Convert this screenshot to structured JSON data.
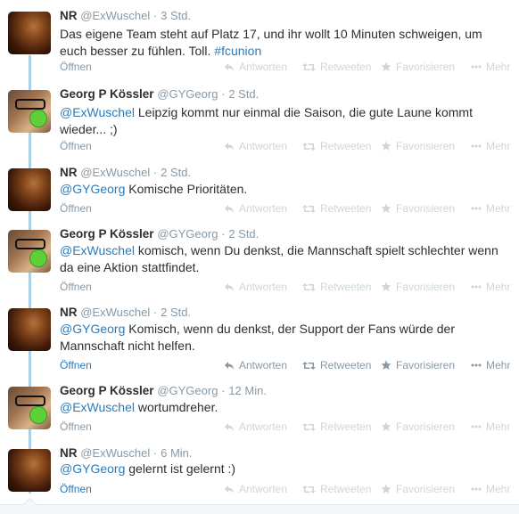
{
  "actions": {
    "open": "Öffnen",
    "reply": "Antworten",
    "retweet": "Retweeten",
    "favorite": "Favorisieren",
    "more": "Mehr"
  },
  "tweets": [
    {
      "name": "NR",
      "handle": "@ExWuschel",
      "time": "3 Std.",
      "parts": [
        {
          "t": "Das eigene Team steht auf Platz 17, und ihr wollt 10 Minuten schweigen, um euch besser zu fühlen. Toll. ",
          "link": false
        },
        {
          "t": "#fcunion",
          "link": true
        }
      ]
    },
    {
      "name": "Georg P Kössler",
      "handle": "@GYGeorg",
      "time": "2 Std.",
      "parts": [
        {
          "t": "@ExWuschel",
          "link": true
        },
        {
          "t": " Leipzig kommt nur einmal die Saison, die gute Laune kommt wieder... ;)",
          "link": false
        }
      ]
    },
    {
      "name": "NR",
      "handle": "@ExWuschel",
      "time": "2 Std.",
      "parts": [
        {
          "t": "@GYGeorg",
          "link": true
        },
        {
          "t": " Komische Prioritäten.",
          "link": false
        }
      ]
    },
    {
      "name": "Georg P Kössler",
      "handle": "@GYGeorg",
      "time": "2 Std.",
      "parts": [
        {
          "t": "@ExWuschel",
          "link": true
        },
        {
          "t": " komisch, wenn Du denkst, die Mannschaft spielt schlechter wenn da eine Aktion stattfindet.",
          "link": false
        }
      ]
    },
    {
      "name": "NR",
      "handle": "@ExWuschel",
      "time": "2 Std.",
      "parts": [
        {
          "t": "@GYGeorg",
          "link": true
        },
        {
          "t": " Komisch, wenn du denkst, der Support der Fans würde der Mannschaft nicht helfen.",
          "link": false
        }
      ]
    },
    {
      "name": "Georg P Kössler",
      "handle": "@GYGeorg",
      "time": "12 Min.",
      "parts": [
        {
          "t": "@ExWuschel",
          "link": true
        },
        {
          "t": " wortumdreher.",
          "link": false
        }
      ]
    },
    {
      "name": "NR",
      "handle": "@ExWuschel",
      "time": "6 Min.",
      "parts": [
        {
          "t": "@GYGeorg",
          "link": true
        },
        {
          "t": " gelernt ist gelernt :)",
          "link": false
        }
      ]
    }
  ],
  "colors": {
    "link": "#2b7bb9",
    "muted": "#8899a6",
    "action_faded": "#ccd6dd",
    "thread_line": "#a9d0e6"
  },
  "icons": {
    "reply": "reply-arrow-icon",
    "retweet": "retweet-arrows-icon",
    "favorite": "star-icon",
    "more": "ellipsis-icon"
  }
}
